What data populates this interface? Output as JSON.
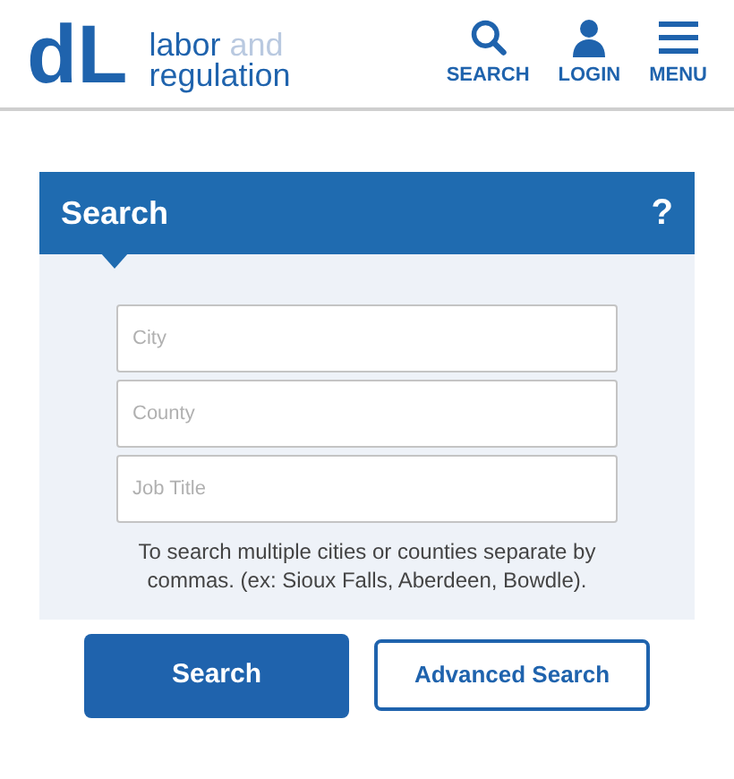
{
  "header": {
    "logo": {
      "letters": "dL",
      "line1": "labor",
      "line1_suffix": "and",
      "line2": "regulation"
    },
    "nav": [
      {
        "kind": "search",
        "label": "SEARCH"
      },
      {
        "kind": "login",
        "label": "LOGIN"
      },
      {
        "kind": "menu",
        "label": "MENU"
      }
    ]
  },
  "panel": {
    "title": "Search",
    "help": "?",
    "fields": [
      {
        "placeholder": "City"
      },
      {
        "placeholder": "County"
      },
      {
        "placeholder": "Job Title"
      }
    ],
    "hint": "To search multiple cities or counties separate by commas. (ex: Sioux Falls, Aberdeen, Bowdle)."
  },
  "buttons": [
    {
      "kind": "primary",
      "label": "Search"
    },
    {
      "kind": "outline",
      "label": "Advanced Search"
    }
  ]
}
